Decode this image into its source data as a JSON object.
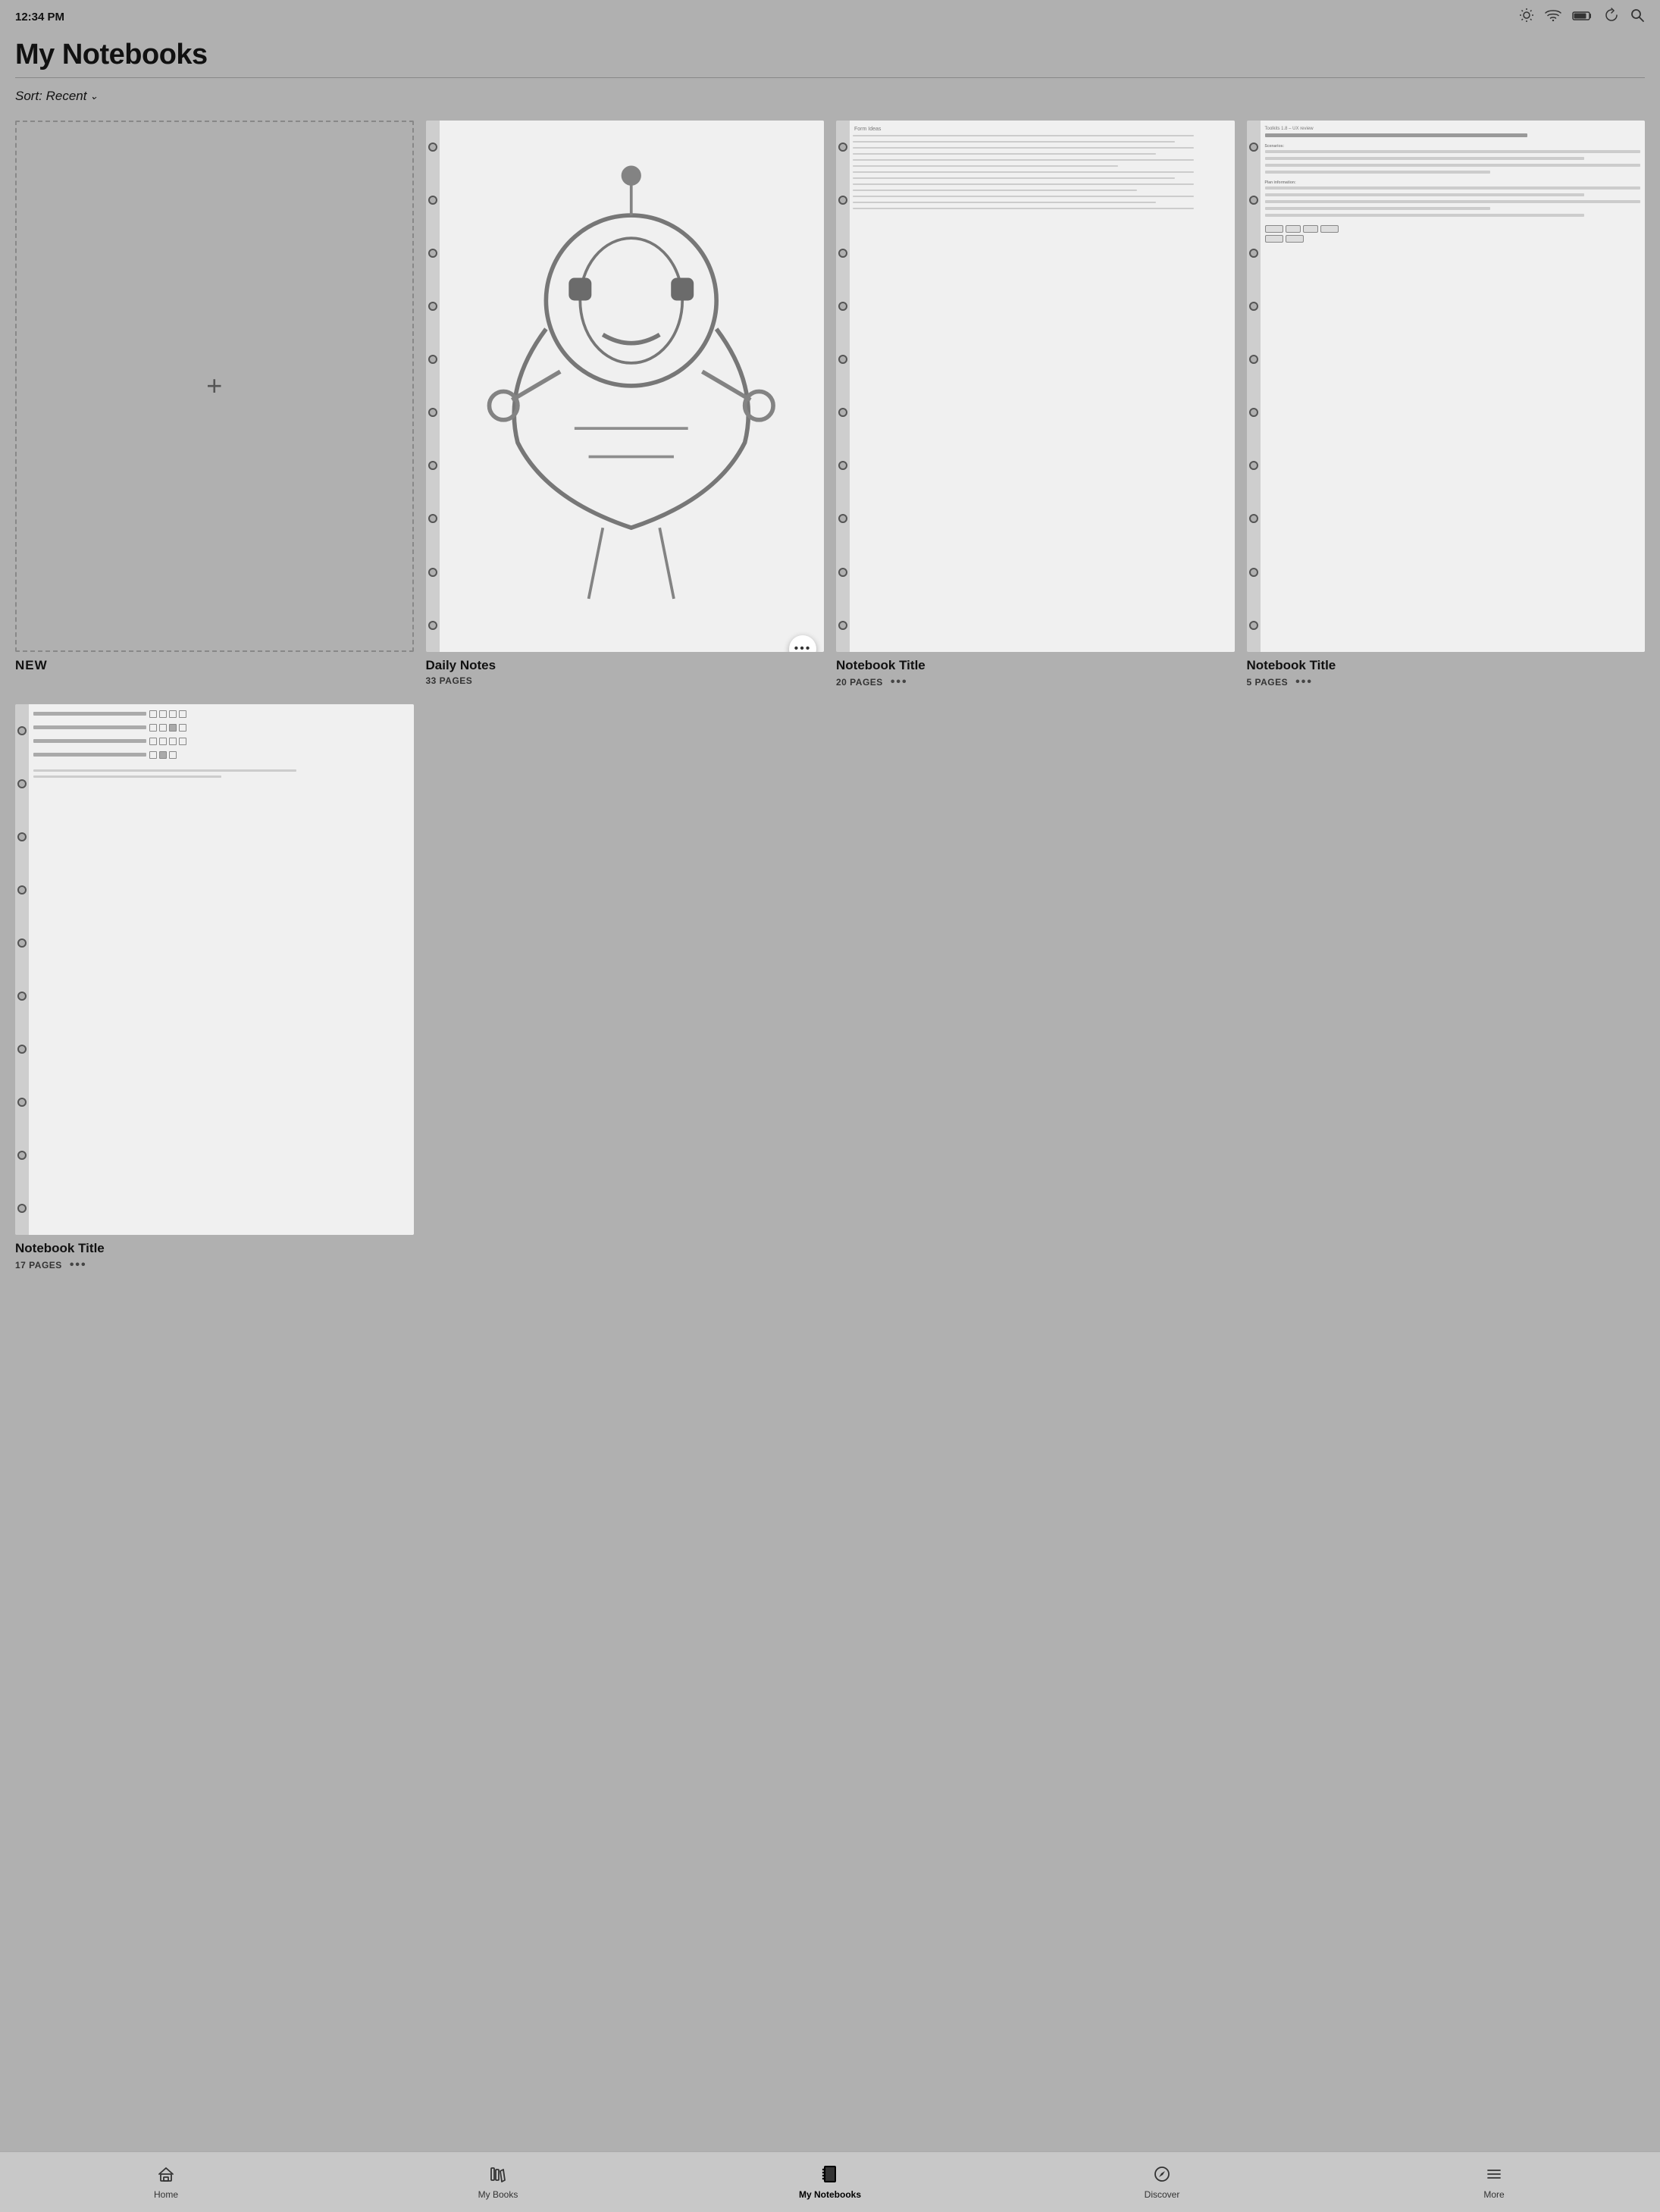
{
  "status": {
    "time": "12:34 PM"
  },
  "header": {
    "title": "My Notebooks",
    "sort_label": "Sort: Recent"
  },
  "notebooks": [
    {
      "id": "new",
      "type": "new",
      "label": "NEW",
      "pages": null
    },
    {
      "id": "daily-notes",
      "type": "sketch",
      "title": "Daily Notes",
      "pages": "33 PAGES",
      "has_floating_more": true
    },
    {
      "id": "notebook-2",
      "type": "lined",
      "title": "Notebook Title",
      "pages": "20 PAGES",
      "has_floating_more": false
    },
    {
      "id": "notebook-3",
      "type": "text",
      "title": "Notebook Title",
      "pages": "5 PAGES",
      "has_floating_more": false
    },
    {
      "id": "notebook-4",
      "type": "options",
      "title": "Notebook Title",
      "pages": "17 PAGES",
      "has_floating_more": false
    }
  ],
  "nav": {
    "items": [
      {
        "id": "home",
        "label": "Home",
        "active": false
      },
      {
        "id": "my-books",
        "label": "My Books",
        "active": false
      },
      {
        "id": "my-notebooks",
        "label": "My Notebooks",
        "active": true
      },
      {
        "id": "discover",
        "label": "Discover",
        "active": false
      },
      {
        "id": "more",
        "label": "More",
        "active": false
      }
    ]
  },
  "more_dots": "•••",
  "dots_floating": "•••"
}
